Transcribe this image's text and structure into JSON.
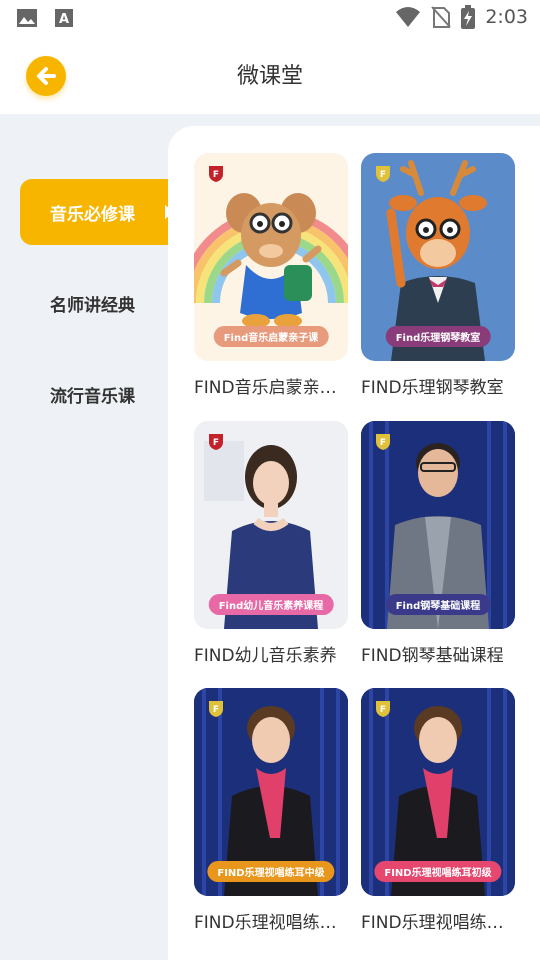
{
  "status_bar": {
    "time": "2:03",
    "left_icons": [
      "image-icon",
      "a-box-icon"
    ],
    "right_icons": [
      "wifi-icon",
      "no-sim-icon",
      "battery-charging-icon"
    ]
  },
  "header": {
    "title": "微课堂",
    "back_icon": "arrow-left-icon"
  },
  "colors": {
    "accent": "#f7b500",
    "background": "#eef2f6"
  },
  "sidebar": {
    "items": [
      {
        "label": "音乐必修课",
        "active": true
      },
      {
        "label": "名师讲经典",
        "active": false
      },
      {
        "label": "流行音乐课",
        "active": false
      }
    ]
  },
  "courses": [
    {
      "title": "FIND音乐启蒙亲…",
      "badge": "Find音乐启蒙亲子课",
      "badge_color": "#e79a7c"
    },
    {
      "title": "FIND乐理钢琴教室",
      "badge": "Find乐理钢琴教室",
      "badge_color": "#8a3b7a"
    },
    {
      "title": "FIND幼儿音乐素养",
      "badge": "Find幼儿音乐素养课程",
      "badge_color": "#e76aa7"
    },
    {
      "title": "FIND钢琴基础课程",
      "badge": "Find钢琴基础课程",
      "badge_color": "#3b3a8a"
    },
    {
      "title": "FIND乐理视唱练…",
      "badge": "FIND乐理视唱练耳中级",
      "badge_color": "#e8961c"
    },
    {
      "title": "FIND乐理视唱练…",
      "badge": "FIND乐理视唱练耳初级",
      "badge_color": "#e6476f"
    }
  ]
}
